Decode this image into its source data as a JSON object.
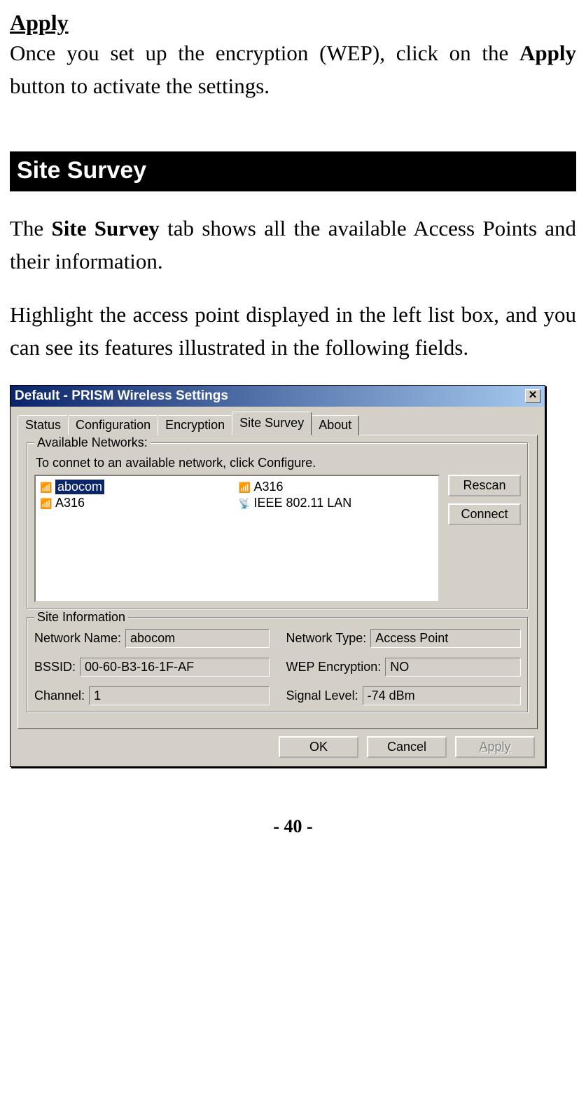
{
  "heading_apply": "Apply",
  "para1_pre": "Once you set up the encryption (WEP), click on the ",
  "para1_bold": "Apply",
  "para1_post": " button to activate the settings.",
  "section_title": "Site Survey",
  "para2_pre": "The ",
  "para2_bold": "Site Survey",
  "para2_post": " tab shows all the available Access Points and their information.",
  "para3": "Highlight the access point displayed in the left list box, and you can see its features illustrated in the following fields.",
  "dialog": {
    "title": "Default - PRISM Wireless Settings",
    "tabs": [
      "Status",
      "Configuration",
      "Encryption",
      "Site Survey",
      "About"
    ],
    "active_tab": "Site Survey",
    "available": {
      "legend": "Available Networks:",
      "hint": "To connet to an available network, click Configure.",
      "col1": [
        {
          "name": "abocom",
          "selected": true
        },
        {
          "name": "A316",
          "selected": false
        }
      ],
      "col2": [
        {
          "name": "A316",
          "selected": false
        },
        {
          "name": "IEEE 802.11 LAN",
          "selected": false
        }
      ],
      "rescan": "Rescan",
      "connect": "Connect"
    },
    "siteinfo": {
      "legend": "Site Information",
      "network_name_label": "Network Name:",
      "network_name": "abocom",
      "network_type_label": "Network Type:",
      "network_type": "Access Point",
      "bssid_label": "BSSID:",
      "bssid": "00-60-B3-16-1F-AF",
      "wep_label": "WEP Encryption:",
      "wep": "NO",
      "channel_label": "Channel:",
      "channel": "1",
      "signal_label": "Signal Level:",
      "signal": "-74 dBm"
    },
    "buttons": {
      "ok": "OK",
      "cancel": "Cancel",
      "apply": "Apply"
    }
  },
  "page_number": "- 40 -"
}
